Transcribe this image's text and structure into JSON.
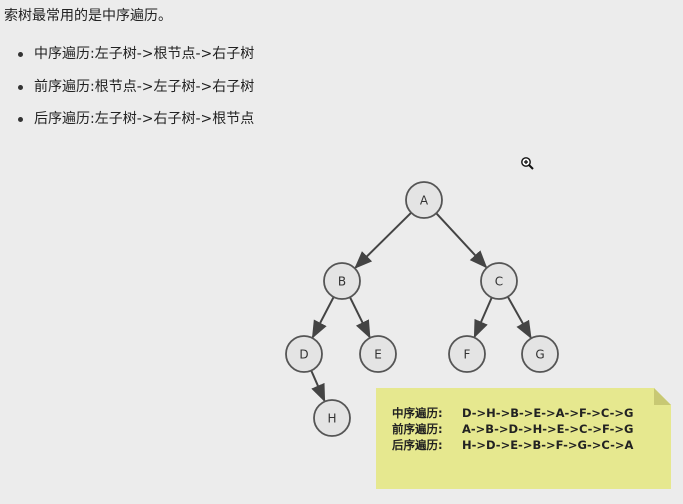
{
  "intro_text": "索树最常用的是中序遍历。",
  "traversals": [
    {
      "text": "中序遍历:左子树->根节点->右子树"
    },
    {
      "text": "前序遍历:根节点->左子树->右子树"
    },
    {
      "text": "后序遍历:左子树->右子树->根节点"
    }
  ],
  "tree": {
    "nodes": [
      {
        "id": "A",
        "label": "A"
      },
      {
        "id": "B",
        "label": "B"
      },
      {
        "id": "C",
        "label": "C"
      },
      {
        "id": "D",
        "label": "D"
      },
      {
        "id": "E",
        "label": "E"
      },
      {
        "id": "F",
        "label": "F"
      },
      {
        "id": "G",
        "label": "G"
      },
      {
        "id": "H",
        "label": "H"
      }
    ],
    "edges": [
      [
        "A",
        "B"
      ],
      [
        "A",
        "C"
      ],
      [
        "B",
        "D"
      ],
      [
        "B",
        "E"
      ],
      [
        "C",
        "F"
      ],
      [
        "C",
        "G"
      ],
      [
        "D",
        "H"
      ]
    ]
  },
  "note": {
    "rows": [
      {
        "label": "中序遍历:",
        "sequence": "D->H->B->E->A->F->C->G"
      },
      {
        "label": "前序遍历:",
        "sequence": "A->B->D->H->E->C->F->G"
      },
      {
        "label": "后序遍历:",
        "sequence": "H->D->E->B->F->G->C->A"
      }
    ],
    "background": "#e6e88f"
  },
  "icons": {
    "cursor": "zoom-in-cursor-icon"
  }
}
